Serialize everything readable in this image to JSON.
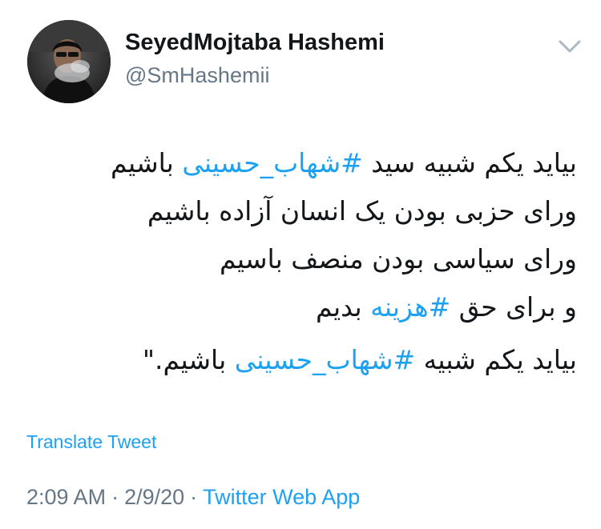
{
  "author": {
    "display_name": "SeyedMojtaba Hashemi",
    "handle": "@SmHashemii"
  },
  "icons": {
    "menu": "chevron-down-icon",
    "avatar": "profile-photo"
  },
  "tweet": {
    "lines": [
      [
        {
          "text": "بیاید یکم شبیه سید ",
          "hashtag": false
        },
        {
          "text": "#شهاب_حسینی",
          "hashtag": true
        },
        {
          "text": " باشیم",
          "hashtag": false
        }
      ],
      [
        {
          "text": "ورای حزبی بودن یک انسان آزاده باشیم",
          "hashtag": false
        }
      ],
      [
        {
          "text": "ورای سیاسی بودن منصف باسیم",
          "hashtag": false
        }
      ],
      [
        {
          "text": "و برای حق ",
          "hashtag": false
        },
        {
          "text": "#هزینه",
          "hashtag": true
        },
        {
          "text": " بدیم",
          "hashtag": false
        }
      ],
      [
        {
          "text": "بیاید یکم شبیه ",
          "hashtag": false
        },
        {
          "text": "#شهاب_حسینی",
          "hashtag": true
        },
        {
          "text": " باشیم.\"",
          "hashtag": false
        }
      ]
    ]
  },
  "translate_label": "Translate Tweet",
  "meta": {
    "time": "2:09 AM",
    "separator": "·",
    "date": "2/9/20",
    "source": "Twitter Web App"
  },
  "colors": {
    "link": "#1da1f2",
    "secondary_text": "#657786",
    "primary_text": "#14171a"
  }
}
